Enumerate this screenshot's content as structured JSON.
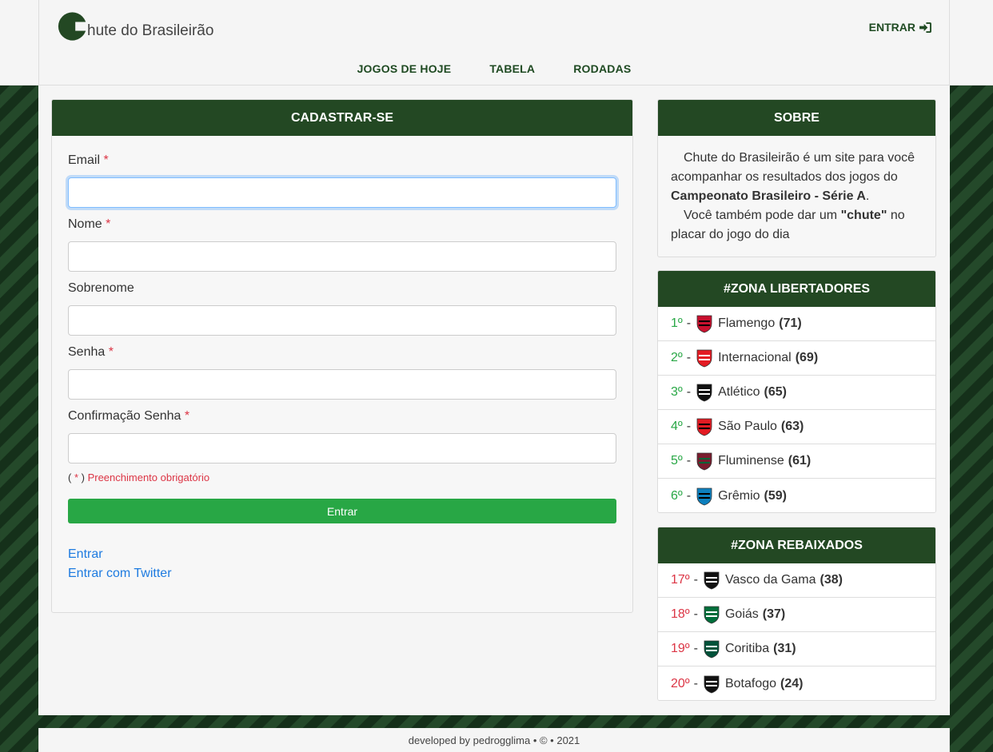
{
  "brand": {
    "name": "hute do Brasileirão"
  },
  "header": {
    "login_label": "ENTRAR"
  },
  "nav": {
    "items": [
      {
        "label": "JOGOS DE HOJE"
      },
      {
        "label": "TABELA"
      },
      {
        "label": "RODADAS"
      }
    ]
  },
  "signup": {
    "title": "CADASTRAR-SE",
    "fields": [
      {
        "label": "Email",
        "required": "*",
        "value": ""
      },
      {
        "label": "Nome",
        "required": "*",
        "value": ""
      },
      {
        "label": "Sobrenome",
        "required": "",
        "value": ""
      },
      {
        "label": "Senha",
        "required": "*",
        "value": ""
      },
      {
        "label": "Confirmação Senha",
        "required": "*",
        "value": ""
      }
    ],
    "note_open": "( ",
    "note_star": "*",
    "note_close": " )",
    "note_text": " Preenchimento obrigatório",
    "submit_label": "Entrar",
    "link_login": "Entrar",
    "link_twitter": "Entrar com Twitter"
  },
  "about": {
    "title": "SOBRE",
    "p1_start": "Chute do Brasileirão é um site para você acompanhar os resultados dos jogos do ",
    "p1_bold": "Campeonato Brasileiro - Série A",
    "p1_end": ".",
    "p2_start": "Você também pode dar um ",
    "p2_bold": "\"chute\"",
    "p2_end": " no placar do jogo do dia"
  },
  "libertadores": {
    "title": "#ZONA LIBERTADORES",
    "teams": [
      {
        "pos": "1º",
        "name": "Flamengo",
        "points": "(71)",
        "crest": "flamengo-crest-icon",
        "c1": "#c8102e",
        "c2": "#000000"
      },
      {
        "pos": "2º",
        "name": "Internacional",
        "points": "(69)",
        "crest": "internacional-crest-icon",
        "c1": "#e31b23",
        "c2": "#ffffff"
      },
      {
        "pos": "3º",
        "name": "Atlético",
        "points": "(65)",
        "crest": "atletico-crest-icon",
        "c1": "#111111",
        "c2": "#ffffff"
      },
      {
        "pos": "4º",
        "name": "São Paulo",
        "points": "(63)",
        "crest": "sao-paulo-crest-icon",
        "c1": "#e31b23",
        "c2": "#000000"
      },
      {
        "pos": "5º",
        "name": "Fluminense",
        "points": "(61)",
        "crest": "fluminense-crest-icon",
        "c1": "#7a1c2e",
        "c2": "#006437"
      },
      {
        "pos": "6º",
        "name": "Grêmio",
        "points": "(59)",
        "crest": "gremio-crest-icon",
        "c1": "#0d80bf",
        "c2": "#000000"
      }
    ]
  },
  "rebaixados": {
    "title": "#ZONA REBAIXADOS",
    "teams": [
      {
        "pos": "17º",
        "name": "Vasco da Gama",
        "points": "(38)",
        "crest": "vasco-crest-icon",
        "c1": "#111111",
        "c2": "#ffffff"
      },
      {
        "pos": "18º",
        "name": "Goiás",
        "points": "(37)",
        "crest": "goias-crest-icon",
        "c1": "#006e3a",
        "c2": "#ffffff"
      },
      {
        "pos": "19º",
        "name": "Coritiba",
        "points": "(31)",
        "crest": "coritiba-crest-icon",
        "c1": "#00523a",
        "c2": "#ffffff"
      },
      {
        "pos": "20º",
        "name": "Botafogo",
        "points": "(24)",
        "crest": "botafogo-crest-icon",
        "c1": "#111111",
        "c2": "#ffffff"
      }
    ]
  },
  "footer": {
    "text": "developed by pedrogglima • © • 2021"
  },
  "colors": {
    "brand_green": "#234823",
    "success": "#28a745",
    "danger": "#dc3545",
    "link": "#1e7be0"
  }
}
